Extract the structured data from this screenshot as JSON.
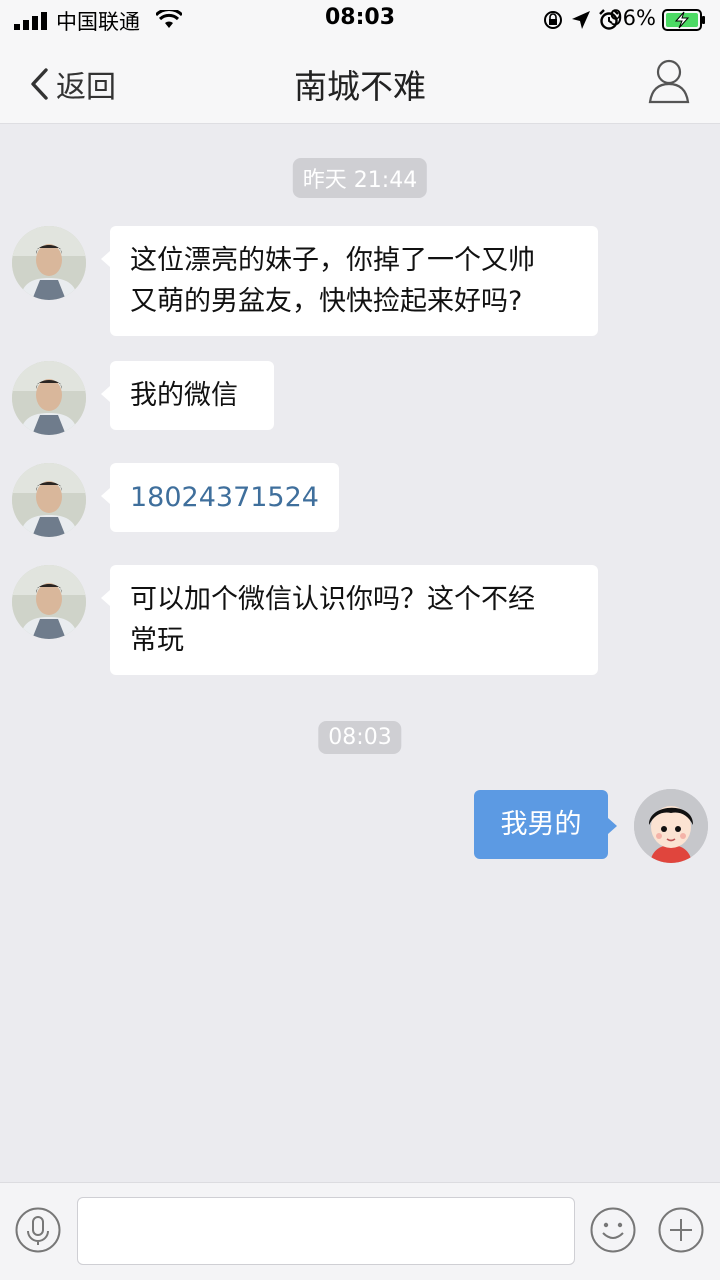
{
  "status_bar": {
    "carrier": "中国联通",
    "time": "08:03",
    "battery_percent": "96%",
    "icons": [
      "signal-icon",
      "wifi-icon",
      "orientation-lock-icon",
      "location-icon",
      "alarm-icon",
      "battery-charging-icon"
    ]
  },
  "nav": {
    "back_label": "返回",
    "title": "南城不难",
    "profile_icon": "person-icon"
  },
  "chat": {
    "timestamp_1": "昨天 21:44",
    "messages_left": [
      {
        "text": "这位漂亮的妹子，你掉了一个又帅\n又萌的男盆友，快快捡起来好吗?"
      },
      {
        "text": "我的微信"
      },
      {
        "text": "18024371524"
      },
      {
        "text": "可以加个微信认识你吗？这个不经\n常玩"
      }
    ],
    "timestamp_2": "08:03",
    "messages_right": [
      {
        "text": "我男的"
      }
    ]
  },
  "input_bar": {
    "voice_icon": "microphone-icon",
    "text_value": "",
    "emoji_icon": "smiley-icon",
    "plus_icon": "plus-icon"
  },
  "colors": {
    "background": "#ebebef",
    "outgoing_bubble": "#5c9ae3",
    "incoming_bubble": "#ffffff",
    "link": "#3f6f9c"
  }
}
